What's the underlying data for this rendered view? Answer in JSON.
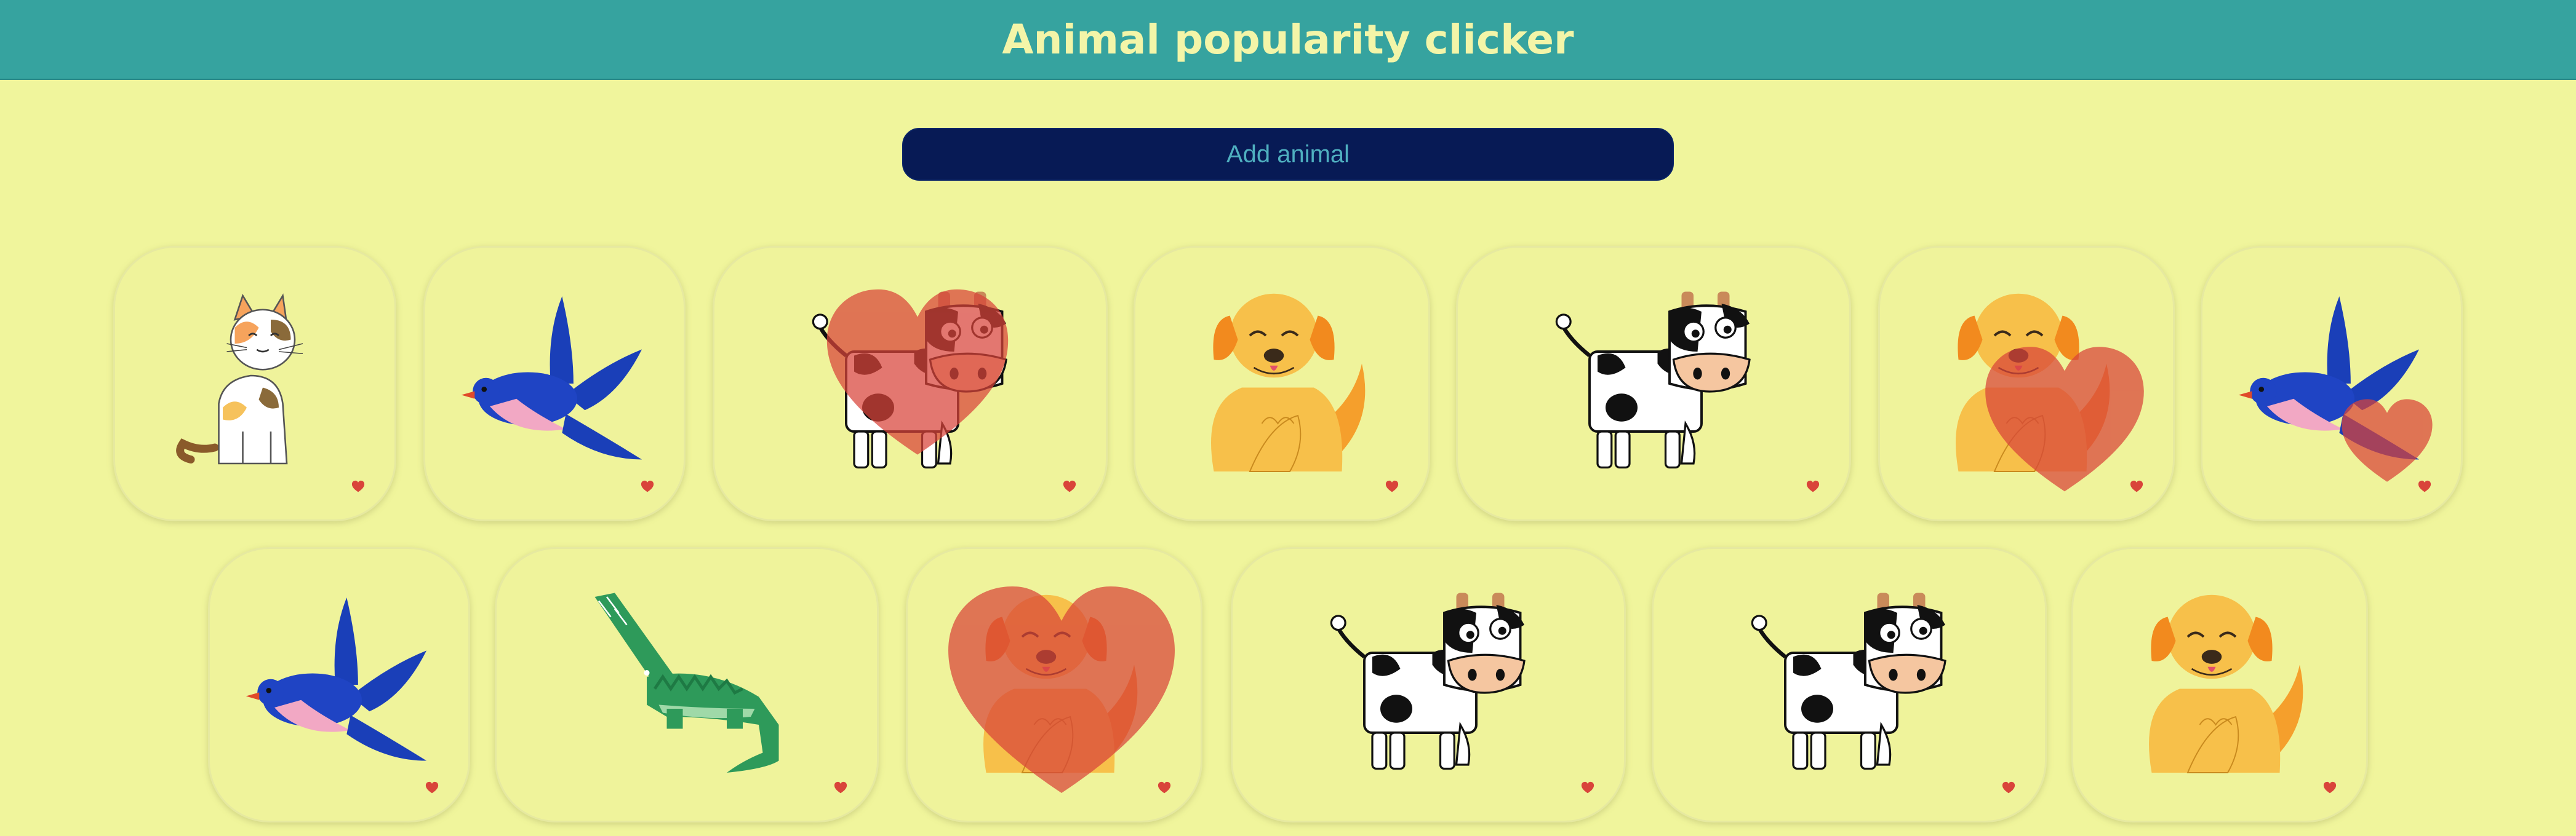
{
  "header": {
    "title": "Animal popularity clicker"
  },
  "controls": {
    "add_label": "Add animal"
  },
  "colors": {
    "header_bg": "#36a39f",
    "page_bg": "#f0f59c",
    "button_bg": "#071a55",
    "button_text": "#4fb0c0",
    "heart": "#d9443a"
  },
  "animals": [
    {
      "kind": "cat-icon",
      "liked": false
    },
    {
      "kind": "bird-icon",
      "liked": false
    },
    {
      "kind": "cow-icon",
      "liked": true
    },
    {
      "kind": "dog-icon",
      "liked": false
    },
    {
      "kind": "cow-icon",
      "liked": false
    },
    {
      "kind": "dog-icon",
      "liked": true
    },
    {
      "kind": "bird-icon",
      "liked": true
    },
    {
      "kind": "bird-icon",
      "liked": false
    },
    {
      "kind": "crocodile-icon",
      "liked": false
    },
    {
      "kind": "dog-icon",
      "liked": true
    },
    {
      "kind": "cow-icon",
      "liked": false
    },
    {
      "kind": "cow-icon",
      "liked": false
    },
    {
      "kind": "dog-icon",
      "liked": false
    }
  ]
}
